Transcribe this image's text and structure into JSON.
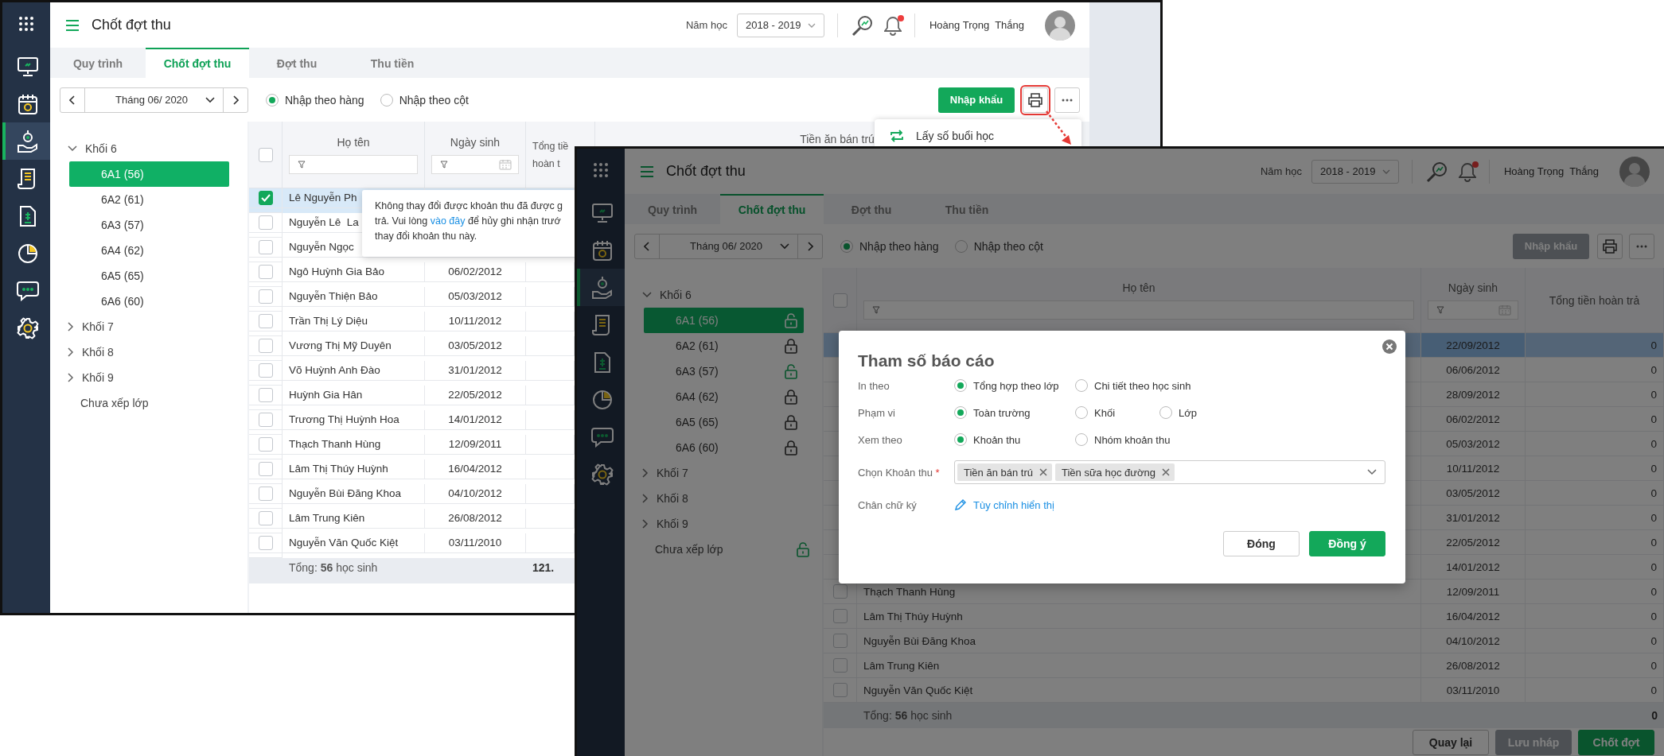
{
  "back_window": {
    "app_title": "Chốt đợt thu",
    "school_year": {
      "label": "Năm học",
      "value": "2018 - 2019"
    },
    "has_notification": true,
    "user_name": "Hoàng Trọng  Thắng",
    "sidebar": [
      {
        "kind": "monitor",
        "selected": false
      },
      {
        "kind": "calendar",
        "selected": false
      },
      {
        "kind": "hand-coin",
        "selected": true
      },
      {
        "kind": "receipt",
        "selected": false
      },
      {
        "kind": "invoice",
        "selected": false
      },
      {
        "kind": "pie",
        "selected": false
      },
      {
        "kind": "chat",
        "selected": false
      },
      {
        "kind": "settings",
        "selected": false
      }
    ],
    "tabs": [
      {
        "label": "Quy trình",
        "selected": false
      },
      {
        "label": "Chốt đợt thu",
        "selected": true
      },
      {
        "label": "Đợt thu",
        "selected": false
      },
      {
        "label": "Thu tiền",
        "selected": false
      }
    ],
    "month": "Tháng 06/ 2020",
    "entry_modes": [
      {
        "label": "Nhập theo hàng",
        "selected": true
      },
      {
        "label": "Nhập theo cột",
        "selected": false
      }
    ],
    "import_button": {
      "label": "Nhập khẩu",
      "disabled": false
    },
    "print_highlighted": true,
    "menu": [
      {
        "label": "Lấy số buổi học"
      }
    ],
    "tree": [
      {
        "label": "Khối 6",
        "expanded": true,
        "children": [
          {
            "label": "6A1 (56)",
            "selected": true
          },
          {
            "label": "6A2 (61)",
            "selected": false
          },
          {
            "label": "6A3 (57)",
            "selected": false
          },
          {
            "label": "6A4 (62)",
            "selected": false
          },
          {
            "label": "6A5 (65)",
            "selected": false
          },
          {
            "label": "6A6 (60)",
            "selected": false
          }
        ]
      },
      {
        "label": "Khối 7",
        "expanded": false
      },
      {
        "label": "Khối 8",
        "expanded": false
      },
      {
        "label": "Khối 9",
        "expanded": false
      },
      {
        "label": "Chưa xếp lớp"
      }
    ],
    "table": {
      "select_all_checked": false,
      "columns": [
        "Họ tên",
        "Ngày sinh",
        "Tổng tiề hoàn t"
      ],
      "group_header": "Tiền ăn bán trú",
      "rows": [
        {
          "name": "Lê Nguyễn Ph",
          "checked": true,
          "selected": true
        },
        {
          "name": "Nguyễn Lê  La",
          "checked": false,
          "selected": false
        },
        {
          "name": "Nguyễn Ngọc",
          "checked": false,
          "selected": false
        },
        {
          "name": "Ngô Huỳnh Gia Bảo",
          "birth_date": "06/02/2012",
          "checked": false,
          "selected": false
        },
        {
          "name": "Nguyễn Thiện Bảo",
          "birth_date": "05/03/2012",
          "checked": false,
          "selected": false
        },
        {
          "name": "Trần Thị Lý Diệu",
          "birth_date": "10/11/2012",
          "checked": false,
          "selected": false
        },
        {
          "name": "Vương Thị Mỹ Duyên",
          "birth_date": "03/05/2012",
          "checked": false,
          "selected": false
        },
        {
          "name": "Võ Huỳnh Anh Đào",
          "birth_date": "31/01/2012",
          "checked": false,
          "selected": false
        },
        {
          "name": "Huỳnh Gia Hân",
          "birth_date": "22/05/2012",
          "checked": false,
          "selected": false
        },
        {
          "name": "Trương Thị Huỳnh Hoa",
          "birth_date": "14/01/2012",
          "checked": false,
          "selected": false
        },
        {
          "name": "Thạch Thanh Hùng",
          "birth_date": "12/09/2011",
          "checked": false,
          "selected": false
        },
        {
          "name": "Lâm Thị Thúy Huỳnh",
          "birth_date": "16/04/2012",
          "checked": false,
          "selected": false
        },
        {
          "name": "Nguyễn Bùi Đăng Khoa",
          "birth_date": "04/10/2012",
          "checked": false,
          "selected": false
        },
        {
          "name": "Lâm Trung Kiên",
          "birth_date": "26/08/2012",
          "checked": false,
          "selected": false
        },
        {
          "name": "Nguyễn Văn Quốc Kiệt",
          "birth_date": "03/11/2010",
          "checked": false,
          "selected": false
        }
      ],
      "footer": {
        "label": "Tổng: **56** học sinh",
        "total": "121."
      }
    },
    "tooltip": {
      "line_1": "Không thay đổi được khoản thu đã được g",
      "line_2_start": "trả. Vui lòng",
      "link": "vào đây",
      "line_2_end": "để hủy ghi nhận trướ",
      "line_3": "thay đổi khoản thu này."
    }
  },
  "front_window": {
    "app_title": "Chốt đợt thu",
    "school_year": {
      "label": "Năm học",
      "value": "2018 - 2019"
    },
    "has_notification": true,
    "user_name": "Hoàng Trọng  Thắng",
    "sidebar": [
      {
        "kind": "monitor",
        "selected": false
      },
      {
        "kind": "calendar",
        "selected": false
      },
      {
        "kind": "hand-coin",
        "selected": true
      },
      {
        "kind": "receipt",
        "selected": false
      },
      {
        "kind": "invoice",
        "selected": false
      },
      {
        "kind": "pie",
        "selected": false
      },
      {
        "kind": "chat",
        "selected": false
      },
      {
        "kind": "settings",
        "selected": false
      }
    ],
    "tabs": [
      {
        "label": "Quy trình",
        "selected": false
      },
      {
        "label": "Chốt đợt thu",
        "selected": true
      },
      {
        "label": "Đợt thu",
        "selected": false
      },
      {
        "label": "Thu tiền",
        "selected": false
      }
    ],
    "month": "Tháng 06/ 2020",
    "entry_modes": [
      {
        "label": "Nhập theo hàng",
        "selected": true
      },
      {
        "label": "Nhập theo cột",
        "selected": false
      }
    ],
    "import_button": {
      "label": "Nhập khẩu",
      "disabled": true
    },
    "print_highlighted": false,
    "tree": [
      {
        "label": "Khối 6",
        "expanded": true,
        "children": [
          {
            "label": "6A1 (56)",
            "selected": true,
            "locked": false
          },
          {
            "label": "6A2 (61)",
            "selected": false,
            "locked": true
          },
          {
            "label": "6A3 (57)",
            "selected": false,
            "locked": false
          },
          {
            "label": "6A4 (62)",
            "selected": false,
            "locked": true
          },
          {
            "label": "6A5 (65)",
            "selected": false,
            "locked": true
          },
          {
            "label": "6A6 (60)",
            "selected": false,
            "locked": true
          }
        ]
      },
      {
        "label": "Khối 7",
        "expanded": false
      },
      {
        "label": "Khối 8",
        "expanded": false
      },
      {
        "label": "Khối 9",
        "expanded": false
      },
      {
        "label": "Chưa xếp lớp",
        "locked": false
      }
    ],
    "table": {
      "select_all_checked": false,
      "columns": [
        "Họ tên",
        "Ngày sinh",
        "Tổng tiền hoàn trả"
      ],
      "rows": [
        {
          "birth_date": "22/09/2012",
          "refund": "0",
          "selected": true
        },
        {
          "birth_date": "06/06/2012",
          "refund": "0",
          "selected": false
        },
        {
          "birth_date": "28/09/2012",
          "refund": "0",
          "selected": false
        },
        {
          "birth_date": "06/02/2012",
          "refund": "0",
          "selected": false
        },
        {
          "birth_date": "05/03/2012",
          "refund": "0",
          "selected": false
        },
        {
          "birth_date": "10/11/2012",
          "refund": "0",
          "selected": false
        },
        {
          "birth_date": "03/05/2012",
          "refund": "0",
          "selected": false
        },
        {
          "birth_date": "31/01/2012",
          "refund": "0",
          "selected": false
        },
        {
          "birth_date": "22/05/2012",
          "refund": "0",
          "selected": false
        },
        {
          "birth_date": "14/01/2012",
          "refund": "0",
          "selected": false
        },
        {
          "name": "Thạch Thanh Hùng",
          "birth_date": "12/09/2011",
          "refund": "0",
          "checked": false,
          "selected": false
        },
        {
          "name": "Lâm Thị Thúy Huỳnh",
          "birth_date": "16/04/2012",
          "refund": "0",
          "checked": false,
          "selected": false
        },
        {
          "name": "Nguyễn Bùi Đăng Khoa",
          "birth_date": "04/10/2012",
          "refund": "0",
          "checked": false,
          "selected": false
        },
        {
          "name": "Lâm Trung Kiên",
          "birth_date": "26/08/2012",
          "refund": "0",
          "checked": false,
          "selected": false
        },
        {
          "name": "Nguyễn Văn Quốc Kiệt",
          "birth_date": "03/11/2010",
          "refund": "0",
          "checked": false,
          "selected": false
        }
      ],
      "footer": {
        "label": "Tổng: **56** học sinh",
        "total": "0"
      }
    },
    "footer_buttons": [
      {
        "label": "Quay lại",
        "kind": "secondary",
        "disabled": false
      },
      {
        "label": "Lưu nháp",
        "kind": "secondary",
        "disabled": true
      },
      {
        "label": "Chốt đợt",
        "kind": "primary",
        "disabled": false
      }
    ],
    "dialog": {
      "title": "Tham số báo cáo",
      "fields": [
        {
          "kind": "radio",
          "label": "In theo",
          "options": [
            {
              "label": "Tổng hợp theo lớp",
              "selected": true
            },
            {
              "label": "Chi tiết theo học sinh",
              "selected": false
            }
          ]
        },
        {
          "kind": "radio",
          "label": "Phạm vi",
          "options": [
            {
              "label": "Toàn trường",
              "selected": true
            },
            {
              "label": "Khối",
              "selected": false
            },
            {
              "label": "Lớp",
              "selected": false
            }
          ]
        },
        {
          "kind": "radio",
          "label": "Xem theo",
          "options": [
            {
              "label": "Khoản thu",
              "selected": true
            },
            {
              "label": "Nhóm khoản thu",
              "selected": false
            }
          ]
        },
        {
          "kind": "multiselect",
          "label": "Chọn Khoản thu",
          "required_mark": "*",
          "chips": [
            "Tiền ăn bán trú",
            "Tiền sữa học đường"
          ]
        },
        {
          "kind": "link",
          "label": "Chân chữ ký",
          "link": "Tùy chỉnh hiển thị"
        }
      ],
      "buttons": [
        {
          "label": "Đóng",
          "kind": "secondary"
        },
        {
          "label": "Đồng ý",
          "kind": "primary"
        }
      ]
    }
  }
}
